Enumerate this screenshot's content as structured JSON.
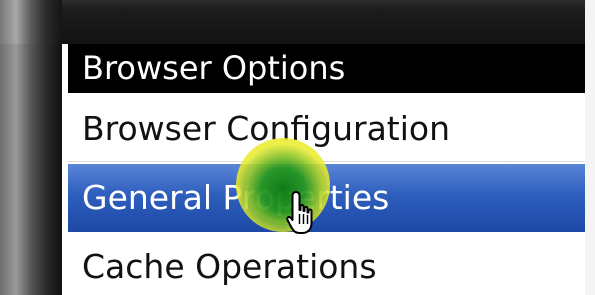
{
  "menu": {
    "title": "Browser Options",
    "items": [
      {
        "label": "Browser Configuration",
        "selected": false
      },
      {
        "label": "General Properties",
        "selected": true
      },
      {
        "label": "Cache Operations",
        "selected": false
      }
    ]
  },
  "colors": {
    "title_bg": "#000000",
    "selected_bg": "#2f5fbe",
    "click_highlight": "#e8e828"
  },
  "icons": {
    "cursor": "hand-pointer-icon"
  }
}
